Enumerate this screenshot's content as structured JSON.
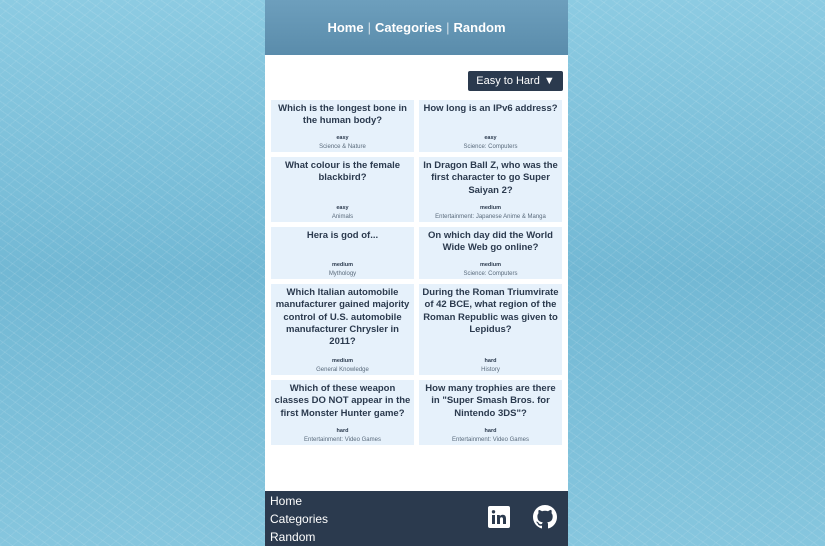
{
  "nav": {
    "home": "Home",
    "categories": "Categories",
    "random": "Random",
    "separator": "|"
  },
  "sort": {
    "label": "Easy to Hard",
    "arrow": "▼"
  },
  "questions": [
    {
      "question": "Which is the longest bone in the human body?",
      "difficulty": "easy",
      "category": "Science & Nature"
    },
    {
      "question": "How long is an IPv6 address?",
      "difficulty": "easy",
      "category": "Science: Computers"
    },
    {
      "question": "What colour is the female blackbird?",
      "difficulty": "easy",
      "category": "Animals"
    },
    {
      "question": "In Dragon Ball Z, who was the first character to go Super Saiyan 2?",
      "difficulty": "medium",
      "category": "Entertainment: Japanese Anime & Manga"
    },
    {
      "question": "Hera is god of...",
      "difficulty": "medium",
      "category": "Mythology"
    },
    {
      "question": "On which day did the World Wide Web go online?",
      "difficulty": "medium",
      "category": "Science: Computers"
    },
    {
      "question": "Which Italian automobile manufacturer gained majority control of U.S. automobile manufacturer Chrysler in 2011?",
      "difficulty": "medium",
      "category": "General Knowledge"
    },
    {
      "question": "During the Roman Triumvirate of 42 BCE, what region of the Roman Republic was given to Lepidus?",
      "difficulty": "hard",
      "category": "History"
    },
    {
      "question": "Which of these weapon classes DO NOT appear in the first Monster Hunter game?",
      "difficulty": "hard",
      "category": "Entertainment: Video Games"
    },
    {
      "question": "How many trophies are there in \"Super Smash Bros. for Nintendo 3DS\"?",
      "difficulty": "hard",
      "category": "Entertainment: Video Games"
    }
  ],
  "footer": {
    "links": [
      "Home",
      "Categories",
      "Random"
    ],
    "icons": [
      "linkedin-icon",
      "github-icon"
    ]
  }
}
